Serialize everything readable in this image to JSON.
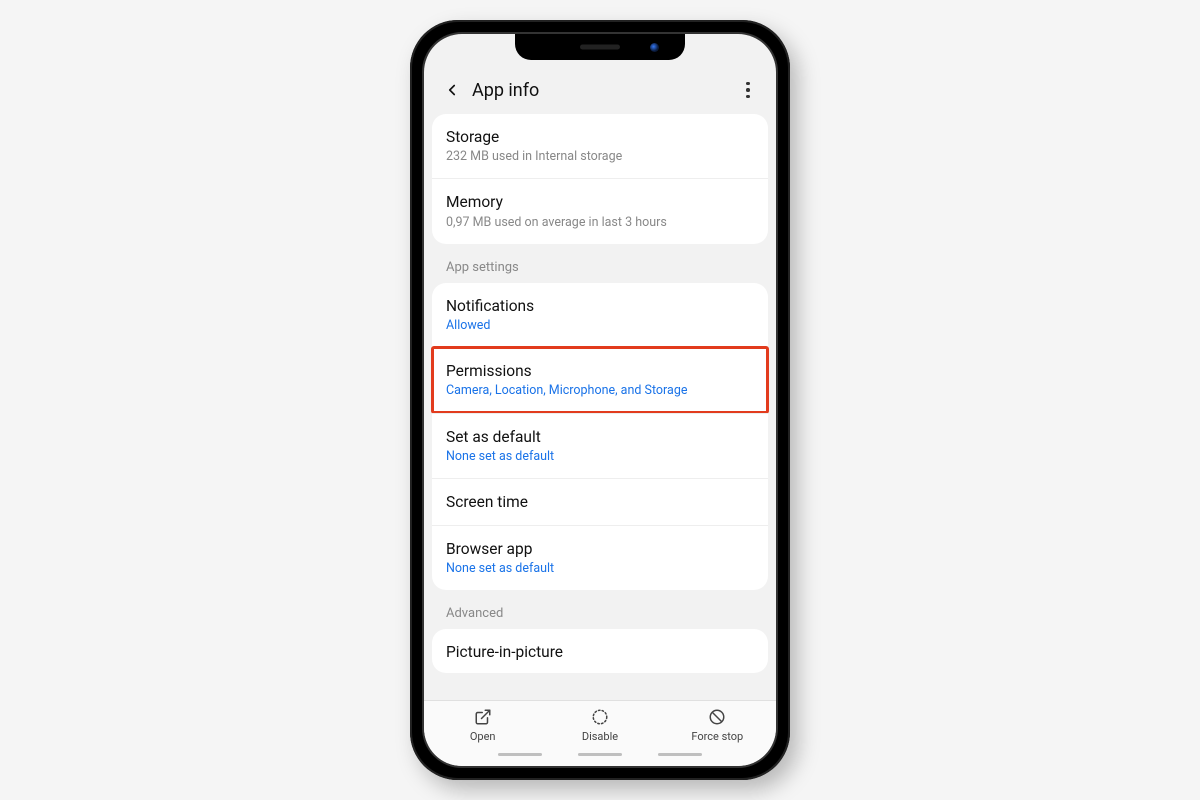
{
  "header": {
    "title": "App info"
  },
  "sections": {
    "usage": {
      "storage": {
        "title": "Storage",
        "sub": "232 MB used in Internal storage"
      },
      "memory": {
        "title": "Memory",
        "sub": "0,97 MB used on average in last 3 hours"
      }
    },
    "appSettings": {
      "label": "App settings",
      "notifications": {
        "title": "Notifications",
        "sub": "Allowed"
      },
      "permissions": {
        "title": "Permissions",
        "sub": "Camera, Location, Microphone, and Storage"
      },
      "setDefault": {
        "title": "Set as default",
        "sub": "None set as default"
      },
      "screenTime": {
        "title": "Screen time"
      },
      "browserApp": {
        "title": "Browser app",
        "sub": "None set as default"
      }
    },
    "advanced": {
      "label": "Advanced",
      "pip": {
        "title": "Picture-in-picture"
      }
    }
  },
  "bottomBar": {
    "open": "Open",
    "disable": "Disable",
    "forceStop": "Force stop"
  }
}
